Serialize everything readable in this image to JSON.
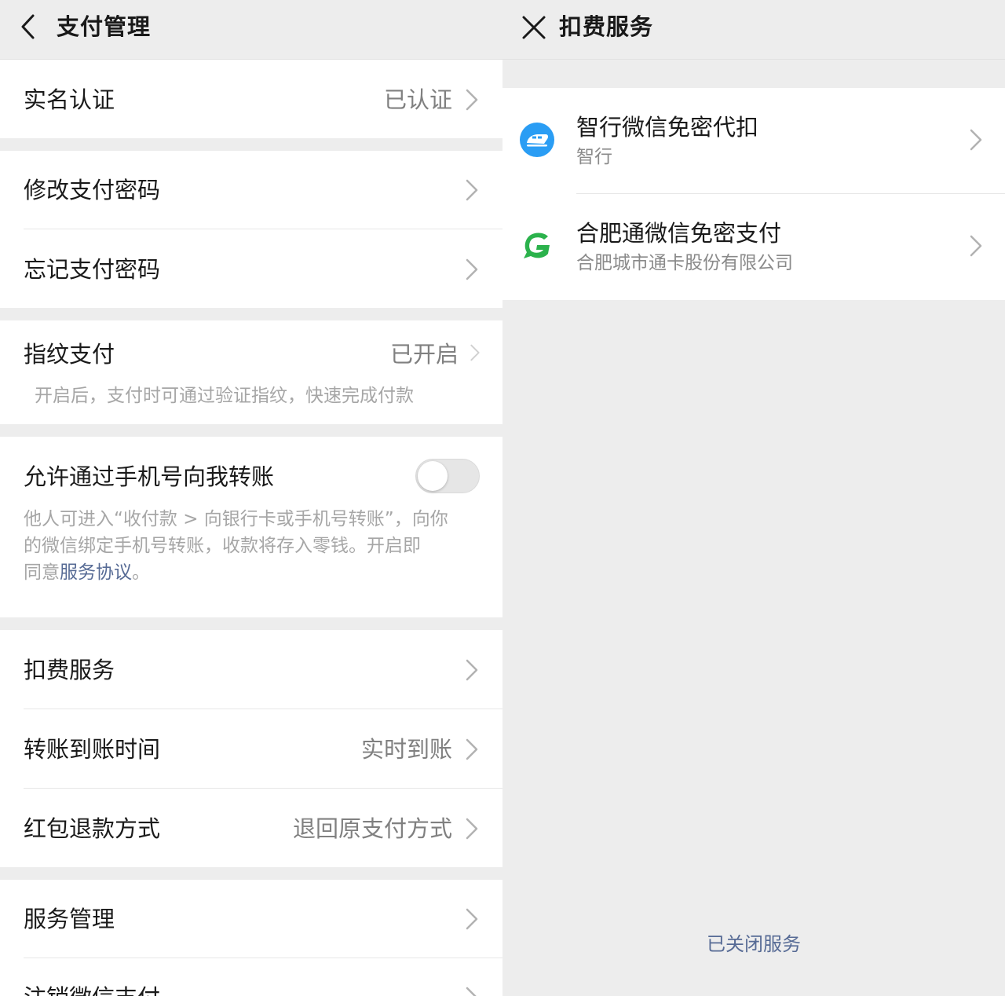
{
  "left": {
    "nav": {
      "title": "支付管理",
      "back_icon": "chevron-left-icon"
    },
    "realname": {
      "label": "实名认证",
      "value": "已认证"
    },
    "password": [
      {
        "label": "修改支付密码"
      },
      {
        "label": "忘记支付密码"
      }
    ],
    "fingerprint": {
      "label": "指纹支付",
      "value": "已开启",
      "desc": "开启后，支付时可通过验证指纹，快速完成付款"
    },
    "phone_transfer": {
      "label": "允许通过手机号向我转账",
      "enabled": false,
      "desc_line1": "他人可进入“收付款 > 向银行卡或手机号转账”，向你",
      "desc_line2": "的微信绑定手机号转账，收款将存入零钱。开启即",
      "desc_line3_prefix": "同意",
      "desc_link": "服务协议",
      "desc_line3_suffix": "。"
    },
    "services": [
      {
        "label": "扣费服务",
        "value": ""
      },
      {
        "label": "转账到账时间",
        "value": "实时到账"
      },
      {
        "label": "红包退款方式",
        "value": "退回原支付方式"
      }
    ],
    "management": [
      {
        "label": "服务管理"
      },
      {
        "label": "注销微信支付"
      }
    ]
  },
  "right": {
    "nav": {
      "title": "扣费服务",
      "close_icon": "close-icon"
    },
    "items": [
      {
        "title": "智行微信免密代扣",
        "subtitle": "智行",
        "icon": "train-icon",
        "icon_color": "#2a9df4"
      },
      {
        "title": "合肥通微信免密支付",
        "subtitle": "合肥城市通卡股份有限公司",
        "icon": "hefeitong-logo-icon",
        "icon_color": "#2bb24c"
      }
    ],
    "closed_link": "已关闭服务"
  },
  "colors": {
    "background": "#ededed",
    "cell": "#ffffff",
    "link": "#576b95",
    "secondary_text": "#808080"
  }
}
